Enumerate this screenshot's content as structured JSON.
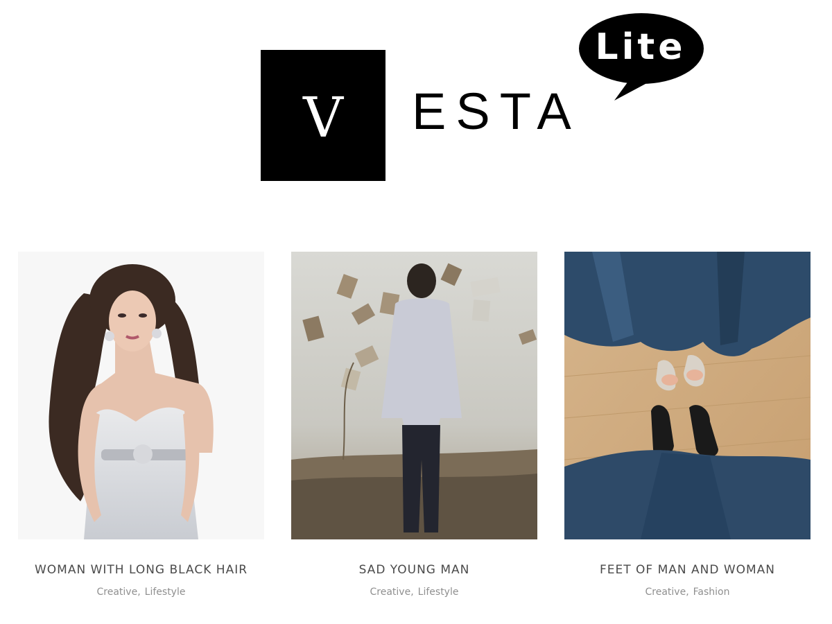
{
  "logo": {
    "initial": "V",
    "wordmark": "ESTA",
    "badge": "Lite"
  },
  "posts": [
    {
      "title": "WOMAN WITH LONG BLACK HAIR",
      "categories": [
        "Creative",
        "Lifestyle"
      ],
      "image_icon": "portrait-photo"
    },
    {
      "title": "SAD YOUNG MAN",
      "categories": [
        "Creative",
        "Lifestyle"
      ],
      "image_icon": "field-photo"
    },
    {
      "title": "FEET OF MAN AND WOMAN",
      "categories": [
        "Creative",
        "Fashion"
      ],
      "image_icon": "shoes-photo"
    }
  ],
  "separator": ",",
  "colors": {
    "background": "#ffffff",
    "logo": "#000000",
    "title": "#4a4a4a",
    "meta": "#8f8f8f"
  }
}
